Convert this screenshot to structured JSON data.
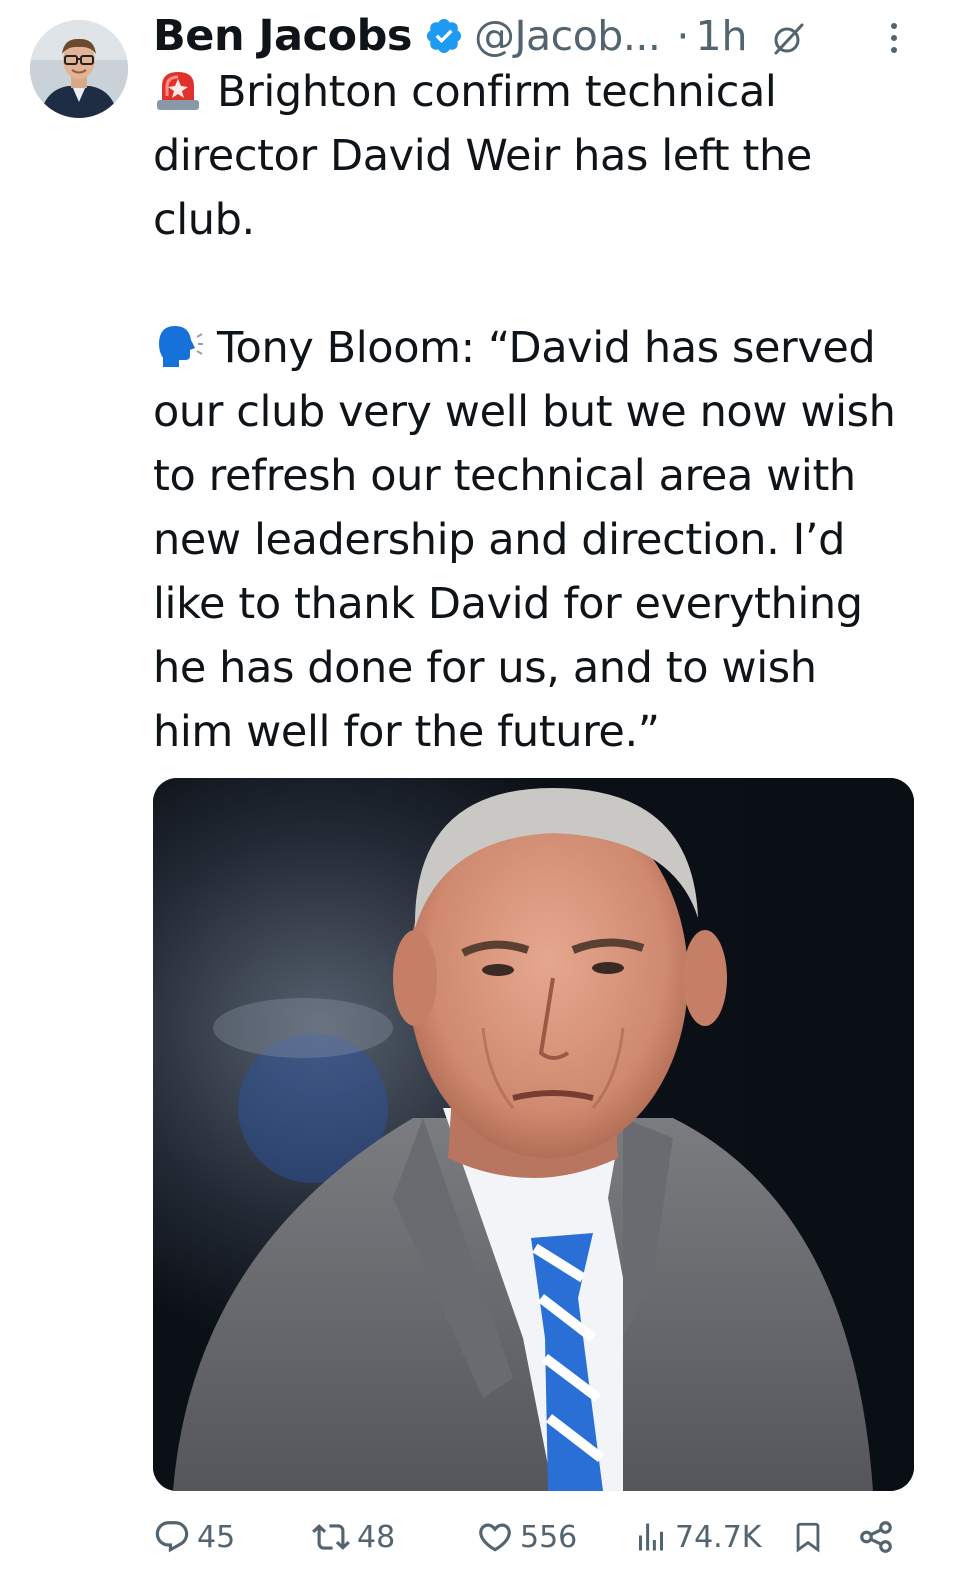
{
  "author": {
    "display_name": "Ben Jacobs",
    "handle": "@Jacob...",
    "separator": "·",
    "time": "1h",
    "avatar_icon": "profile-photo",
    "verified_icon": "verified-badge-icon",
    "verified_color": "#1d9bf0"
  },
  "tweet": {
    "paragraphs": [
      {
        "emoji": "rotating-light",
        "lines": [
          "Brighton confirm technical",
          "director David Weir has left the",
          "club."
        ]
      },
      {
        "emoji": "speaking-head",
        "lines": [
          "Tony Bloom: “David has served",
          "our club very well but we now wish",
          "to refresh our technical area with",
          "new leadership and direction. I’d",
          "like to thank David for everything",
          "he has done for us, and to wish",
          "him well for the future.”"
        ]
      }
    ]
  },
  "media": {
    "type": "photo",
    "subject": "man in grey suit with blue and white striped tie"
  },
  "actions": {
    "replies": "45",
    "reposts": "48",
    "likes": "556",
    "views": "74.7K",
    "reply_icon": "reply-icon",
    "repost_icon": "repost-icon",
    "like_icon": "heart-icon",
    "views_icon": "views-chart-icon",
    "bookmark_icon": "bookmark-icon",
    "share_icon": "share-icon",
    "icon_color": "#536471"
  }
}
